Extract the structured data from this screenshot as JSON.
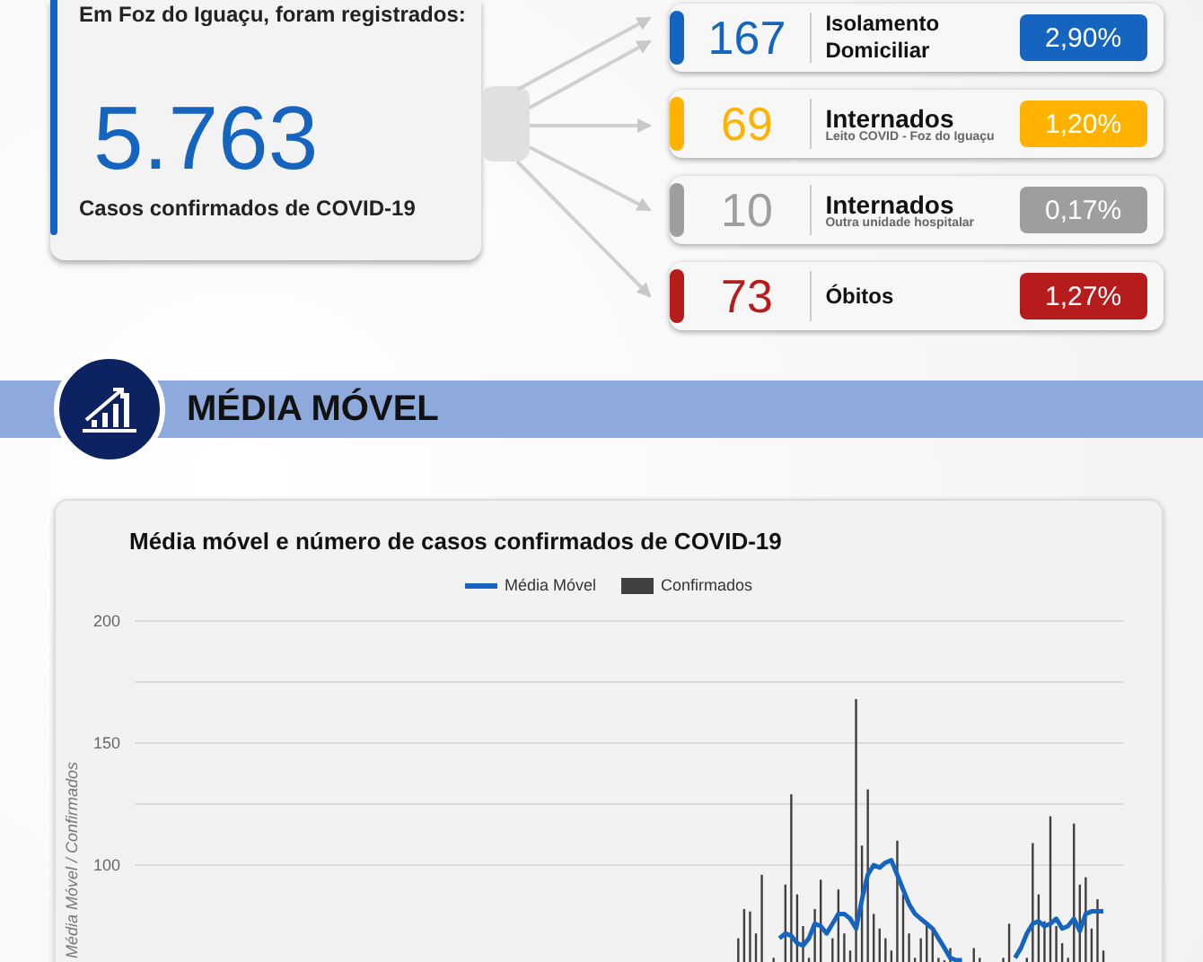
{
  "summary": {
    "heading": "Em Foz do Iguaçu, foram registrados:",
    "total": "5.763",
    "caption": "Casos confirmados de COVID-19"
  },
  "breakdown": [
    {
      "value": "167",
      "label": "Isolamento Domiciliar",
      "percent": "2,90%",
      "color": "#1565c0"
    },
    {
      "value": "69",
      "label": "Internados",
      "sublabel": "Leito COVID - Foz do Iguaçu",
      "percent": "1,20%",
      "color": "#ffb300"
    },
    {
      "value": "10",
      "label": "Internados",
      "sublabel": "Outra unidade hospitalar",
      "percent": "0,17%",
      "color": "#9e9e9e"
    },
    {
      "value": "73",
      "label": "Óbitos",
      "percent": "1,27%",
      "color": "#b71c1c"
    }
  ],
  "section": {
    "title": "MÉDIA MÓVEL"
  },
  "chart": {
    "chart_data": {
      "type": "bar",
      "title": "Média móvel e número de casos confirmados de COVID-19",
      "ylabel": "Média Móvel / Confirmados",
      "ylim": [
        60,
        200
      ],
      "yticks": [
        100,
        150,
        200
      ],
      "series": [
        {
          "name": "Confirmados",
          "color": "#404040",
          "values": [
            null,
            null,
            null,
            null,
            null,
            null,
            null,
            null,
            null,
            null,
            null,
            null,
            null,
            null,
            null,
            null,
            null,
            null,
            null,
            null,
            null,
            null,
            null,
            null,
            null,
            null,
            null,
            null,
            null,
            null,
            null,
            null,
            null,
            null,
            null,
            null,
            null,
            null,
            null,
            null,
            null,
            null,
            null,
            null,
            null,
            null,
            null,
            null,
            null,
            null,
            null,
            null,
            null,
            null,
            null,
            null,
            null,
            null,
            null,
            null,
            null,
            null,
            null,
            null,
            null,
            null,
            null,
            null,
            null,
            null,
            null,
            null,
            null,
            null,
            null,
            null,
            null,
            null,
            null,
            null,
            null,
            null,
            null,
            null,
            null,
            null,
            null,
            null,
            null,
            null,
            null,
            null,
            null,
            null,
            null,
            null,
            null,
            null,
            null,
            null,
            null,
            null,
            70,
            82,
            81,
            72,
            96,
            null,
            62,
            null,
            92,
            129,
            88,
            75,
            62,
            82,
            94,
            null,
            70,
            90,
            72,
            65,
            168,
            108,
            131,
            80,
            74,
            70,
            65,
            110,
            88,
            72,
            62,
            70,
            76,
            74,
            62,
            61,
            66,
            null,
            null,
            null,
            66,
            62,
            null,
            null,
            null,
            62,
            76,
            null,
            null,
            62,
            109,
            88,
            77,
            120,
            75,
            68,
            62,
            117,
            92,
            95,
            74,
            86,
            65,
            null,
            null,
            null
          ]
        },
        {
          "name": "Média Móvel",
          "type": "line",
          "color": "#1565c0",
          "values": [
            null,
            null,
            null,
            null,
            null,
            null,
            null,
            null,
            null,
            null,
            null,
            null,
            null,
            null,
            null,
            null,
            null,
            null,
            null,
            null,
            null,
            null,
            null,
            null,
            null,
            null,
            null,
            null,
            null,
            null,
            null,
            null,
            null,
            null,
            null,
            null,
            null,
            null,
            null,
            null,
            null,
            null,
            null,
            null,
            null,
            null,
            null,
            null,
            null,
            null,
            null,
            null,
            null,
            null,
            null,
            null,
            null,
            null,
            null,
            null,
            null,
            null,
            null,
            null,
            null,
            null,
            null,
            null,
            null,
            null,
            null,
            null,
            null,
            null,
            null,
            null,
            null,
            null,
            null,
            null,
            null,
            null,
            null,
            null,
            null,
            null,
            null,
            null,
            null,
            null,
            null,
            null,
            null,
            null,
            null,
            null,
            null,
            null,
            null,
            null,
            null,
            null,
            null,
            null,
            null,
            null,
            null,
            null,
            null,
            70,
            72,
            71,
            68,
            67,
            70,
            76,
            75,
            72,
            76,
            80,
            80,
            78,
            74,
            86,
            96,
            100,
            99,
            101,
            102,
            96,
            90,
            84,
            80,
            78,
            76,
            74,
            70,
            66,
            62,
            61,
            61,
            null,
            null,
            null,
            null,
            null,
            null,
            null,
            null,
            62,
            66,
            72,
            76,
            77,
            75,
            76,
            78,
            74,
            75,
            78,
            73,
            80,
            81,
            81,
            81,
            null,
            null,
            null
          ]
        }
      ]
    }
  }
}
